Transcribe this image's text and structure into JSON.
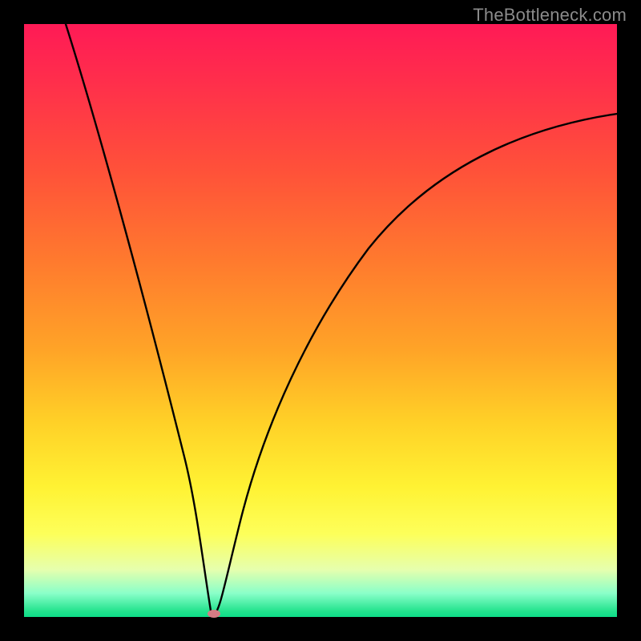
{
  "brand": "TheBottleneck.com",
  "chart_data": {
    "type": "line",
    "title": "",
    "xlabel": "",
    "ylabel": "",
    "xlim": [
      0,
      100
    ],
    "ylim": [
      0,
      100
    ],
    "grid": false,
    "legend": false,
    "background_gradient": {
      "direction": "vertical",
      "stops": [
        {
          "pos": 0,
          "color": "#ff1a56"
        },
        {
          "pos": 25,
          "color": "#ff5239"
        },
        {
          "pos": 55,
          "color": "#ffa427"
        },
        {
          "pos": 78,
          "color": "#fff233"
        },
        {
          "pos": 96,
          "color": "#8affc9"
        },
        {
          "pos": 100,
          "color": "#0ddc88"
        }
      ]
    },
    "series": [
      {
        "name": "left-curve",
        "x": [
          7,
          10,
          15,
          20,
          25,
          28,
          30,
          31,
          32
        ],
        "values": [
          100,
          88,
          68,
          48,
          27,
          13,
          4,
          1,
          0
        ]
      },
      {
        "name": "right-curve",
        "x": [
          32,
          33,
          35,
          38,
          42,
          48,
          55,
          63,
          72,
          82,
          92,
          100
        ],
        "values": [
          0,
          2,
          9,
          20,
          33,
          48,
          59,
          68,
          75,
          80,
          83,
          85
        ]
      }
    ],
    "annotations": [
      {
        "name": "min-marker",
        "x": 32,
        "y": 0,
        "color": "#d77c85"
      }
    ]
  }
}
